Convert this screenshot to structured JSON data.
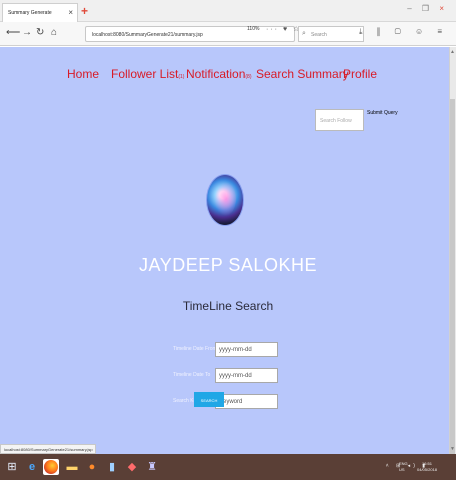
{
  "browser": {
    "tab_title": "Summary Generate",
    "tab_close": "×",
    "new_tab": "+",
    "url": "localhost:8080/SummaryGenerate21/summary.jsp",
    "zoom": "110%",
    "url_icons": "··· ♥ ☆",
    "search_placeholder": "Search",
    "toolbar_icons": "⤓ ⫼ ▢ ☺ ≡",
    "window_controls": "– ❐",
    "window_close": "×",
    "status_url": "localhost:8080/SummaryGenerate21/summary.jsp"
  },
  "nav": {
    "home": "Home",
    "follower_list": "Follower List",
    "follower_count": "(1)",
    "notification": "Notification",
    "notification_count": "(8)",
    "search_summary": "Search Summary",
    "profile": "Profile"
  },
  "header_search": {
    "placeholder": "Search Follow",
    "submit_label": "Submit Query"
  },
  "profile": {
    "name": "JAYDEEP SALOKHE"
  },
  "timeline": {
    "title": "TimeLine Search",
    "fields": [
      {
        "label": "Timeline Date From",
        "placeholder": "yyyy-mm-dd"
      },
      {
        "label": "Timeline Date To",
        "placeholder": "yyyy-mm-dd"
      },
      {
        "label": "Search Keyword",
        "placeholder": "Keyword"
      }
    ],
    "button_label": "SEARCH"
  },
  "taskbar": {
    "tray_icons": "˄ ⊞ ◂) ▮",
    "language": "ENG",
    "region": "US",
    "time": "16:51",
    "date": "04/05/2018"
  },
  "colors": {
    "page_background": "#b8c7fb",
    "nav_link": "#d81b27",
    "button": "#20a7e6",
    "taskbar": "#5a3f36"
  }
}
